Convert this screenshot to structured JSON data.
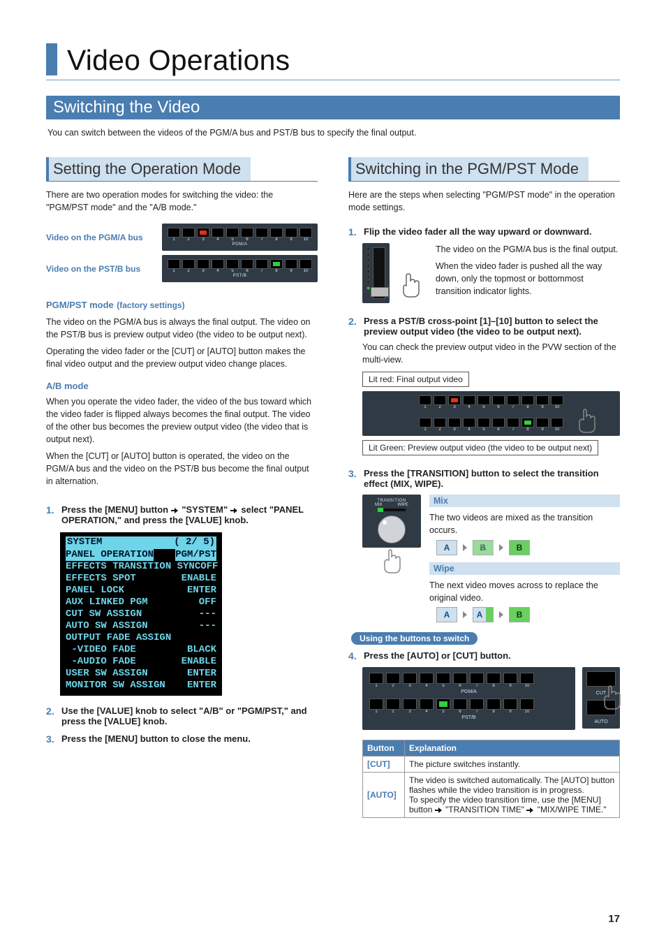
{
  "page_number": "17",
  "title": "Video Operations",
  "section": "Switching the Video",
  "section_intro": "You can switch between the videos of the PGM/A bus and PST/B bus to specify the final output.",
  "left": {
    "sub_title": "Setting the Operation Mode",
    "intro": "There are two operation modes for switching the video: the \"PGM/PST mode\" and the \"A/B mode.\"",
    "bus_a_label": "Video on the PGM/A bus",
    "bus_b_label": "Video on the PST/B bus",
    "bus_caption_a": "PGM/A",
    "bus_caption_b": "PST/B",
    "mode1_head": "PGM/PST mode",
    "mode1_hint": "(factory settings)",
    "mode1_p1": "The video on the PGM/A bus is always the final output. The video on the PST/B bus is preview output video (the video to be output next).",
    "mode1_p2": "Operating the video fader or the [CUT] or [AUTO] button makes the final video output and the preview output video change places.",
    "mode2_head": "A/B mode",
    "mode2_p1": "When you operate the video fader, the video of the bus toward which the video fader is flipped always becomes the final output. The video of the other bus becomes the preview output video (the video that is output next).",
    "mode2_p2": "When the [CUT] or [AUTO] button is operated, the video on the PGM/A bus and the video on the PST/B bus become the final output in alternation.",
    "step1_pre": "Press the [MENU] button ",
    "step1_sys": " \"SYSTEM\" ",
    "step1_post": " select \"PANEL OPERATION,\" and press the [VALUE] knob.",
    "menu": {
      "title": "SYSTEM",
      "page": "( 2/ 5)",
      "rows": [
        [
          "PANEL OPERATION",
          "PGM/PST"
        ],
        [
          "EFFECTS TRANSITION SYNC",
          "OFF"
        ],
        [
          "EFFECTS SPOT",
          "ENABLE"
        ],
        [
          "PANEL LOCK",
          "ENTER"
        ],
        [
          "AUX LINKED PGM",
          "OFF"
        ],
        [
          "CUT SW ASSIGN",
          "---"
        ],
        [
          "AUTO SW ASSIGN",
          "---"
        ],
        [
          "OUTPUT FADE ASSIGN",
          ""
        ],
        [
          " -VIDEO FADE",
          "BLACK"
        ],
        [
          " -AUDIO FADE",
          "ENABLE"
        ],
        [
          "USER SW ASSIGN",
          "ENTER"
        ],
        [
          "MONITOR SW ASSIGN",
          "ENTER"
        ]
      ]
    },
    "step2": "Use the [VALUE] knob to select \"A/B\" or \"PGM/PST,\" and press the [VALUE] knob.",
    "step3": "Press the [MENU] button to close the menu."
  },
  "right": {
    "sub_title": "Switching in the PGM/PST Mode",
    "intro": "Here are the steps when selecting \"PGM/PST mode\" in the operation mode settings.",
    "step1": "Flip the video fader all the way upward or downward.",
    "step1_p1": "The video on the PGM/A bus is the final output.",
    "step1_p2": "When the video fader is pushed all the way down, only the topmost or bottommost transition indicator lights.",
    "step2": "Press a PST/B cross-point [1]–[10] button to select the preview output video (the video to be output next).",
    "step2_p": "You can check the preview output video in the PVW section of the multi-view.",
    "label_red": "Lit red: Final output video",
    "label_green": "Lit Green: Preview output video (the video to be output next)",
    "step3": "Press the [TRANSITION] button to select the transition effect (MIX, WIPE).",
    "trans_panel": {
      "header": "TRANSITION",
      "mix": "MIX",
      "wipe": "WIPE"
    },
    "mix_head": "Mix",
    "mix_text": "The two videos are mixed as the transition occurs.",
    "wipe_head": "Wipe",
    "wipe_text": "The next video moves across to replace the original video.",
    "seq": {
      "A": "A",
      "B": "B"
    },
    "pill": "Using the buttons to switch",
    "step4": "Press the [AUTO] or [CUT] button.",
    "cut_label": "CUT",
    "auto_label": "AUTO",
    "table": {
      "h1": "Button",
      "h2": "Explanation",
      "r1b": "[CUT]",
      "r1t": "The picture switches instantly.",
      "r2b": "[AUTO]",
      "r2t1": "The video is switched automatically. The [AUTO] button flashes while the video transition is in progress.",
      "r2t2_pre": "To specify the video transition time, use the [MENU] button ",
      "r2t2_mid": " \"TRANSITION TIME\" ",
      "r2t2_post": " \"MIX/WIPE TIME.\""
    }
  }
}
